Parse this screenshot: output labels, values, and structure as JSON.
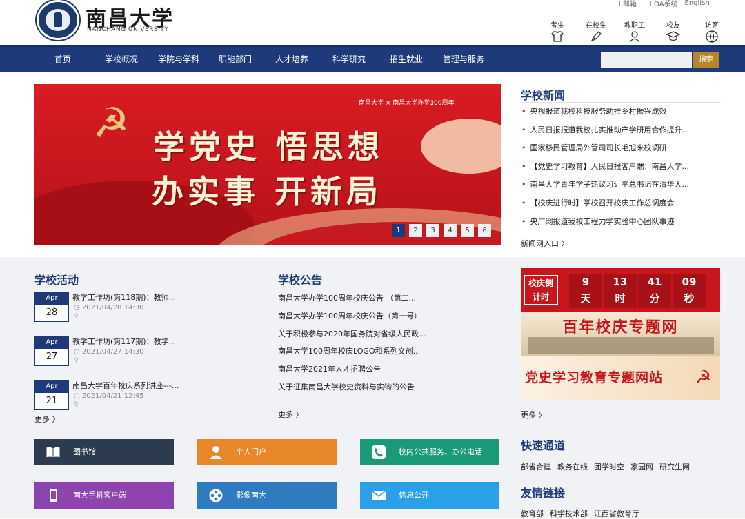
{
  "header": {
    "logo_cn": "南昌大学",
    "logo_en": "NANCHANG UNIVERSITY",
    "top_links": [
      "邮箱",
      "OA系统",
      "English"
    ],
    "roles": [
      "考生",
      "在校生",
      "教职工",
      "校友",
      "访客"
    ]
  },
  "nav": {
    "items": [
      "首页",
      "学校概况",
      "学院与学科",
      "职能部门",
      "人才培养",
      "科学研究",
      "招生就业",
      "管理与服务"
    ],
    "search_placeholder": "",
    "search_button": "搜索"
  },
  "banner": {
    "line1": "学党史 悟思想",
    "line2": "办实事 开新局",
    "logo_text": "南昌大学 × 南昌大学办学100周年",
    "slides": [
      "1",
      "2",
      "3",
      "4",
      "5",
      "6"
    ],
    "active_slide": 1
  },
  "news": {
    "title": "学校新闻",
    "items": [
      "央视报道我校科技服务助推乡村振兴成效",
      "人民日报报道我校扎实推动产学研用合作提升...",
      "国家移民管理局外管司司长毛旭来校调研",
      "【党史学习教育】人民日报客户端：南昌大学...",
      "南昌大学青年学子热议习近平总书记在清华大...",
      "【校庆进行时】学校召开校庆工作总调度会",
      "央广网报道我校工程力学实验中心团队事迹"
    ],
    "more": "新闻网入口 〉"
  },
  "activities": {
    "title": "学校活动",
    "items": [
      {
        "month": "Apr",
        "day": "28",
        "title": "教学工作坊(第118期)：教师...",
        "time": "2021/04/28 14:30"
      },
      {
        "month": "Apr",
        "day": "27",
        "title": "教学工作坊(第117期)：教学...",
        "time": "2021/04/27 14:30"
      },
      {
        "month": "Apr",
        "day": "21",
        "title": "南昌大学百年校庆系列讲座---...",
        "time": "2021/04/21 12:45"
      }
    ],
    "more": "更多 〉"
  },
  "notices": {
    "title": "学校公告",
    "items": [
      "南昌大学办学100周年校庆公告 （第二...",
      "南昌大学办学100周年校庆公告（第一号）",
      "关于积极参与2020年国务院对省级人民政...",
      "南昌大学100周年校庆LOGO和系列文创...",
      "南昌大学2021年人才招聘公告",
      "关于征集南昌大学校史资料与实物的公告"
    ],
    "more": "更多 〉"
  },
  "promo": {
    "countdown_label": "校庆倒计时",
    "countdown": [
      {
        "n": "9",
        "u": "天"
      },
      {
        "n": "13",
        "u": "时"
      },
      {
        "n": "41",
        "u": "分"
      },
      {
        "n": "09",
        "u": "秒"
      }
    ],
    "anniversary": "百年校庆专题网",
    "party": "党史学习教育专题网站",
    "more": "更多 〉"
  },
  "quick": {
    "buttons": [
      {
        "label": "图书馆",
        "color": "#2d3b4e",
        "icon": "book-icon"
      },
      {
        "label": "个人门户",
        "color": "#e8862a",
        "icon": "user-icon"
      },
      {
        "label": "校内公共服务、办公电话",
        "color": "#1a9a79",
        "icon": "phone-icon"
      },
      {
        "label": "南大手机客户端",
        "color": "#8e44ad",
        "icon": "mobile-icon"
      },
      {
        "label": "影像南大",
        "color": "#2f7bbf",
        "icon": "film-icon"
      },
      {
        "label": "信息公开",
        "color": "#2aa0e8",
        "icon": "mail-icon"
      }
    ],
    "channel_title": "快速通道",
    "channel_links": [
      "部省合建",
      "教务在线",
      "团学时空",
      "家园网",
      "研究生网"
    ],
    "friend_title": "友情链接",
    "friend_links": [
      "教育部",
      "科学技术部",
      "江西省教育厅"
    ]
  }
}
